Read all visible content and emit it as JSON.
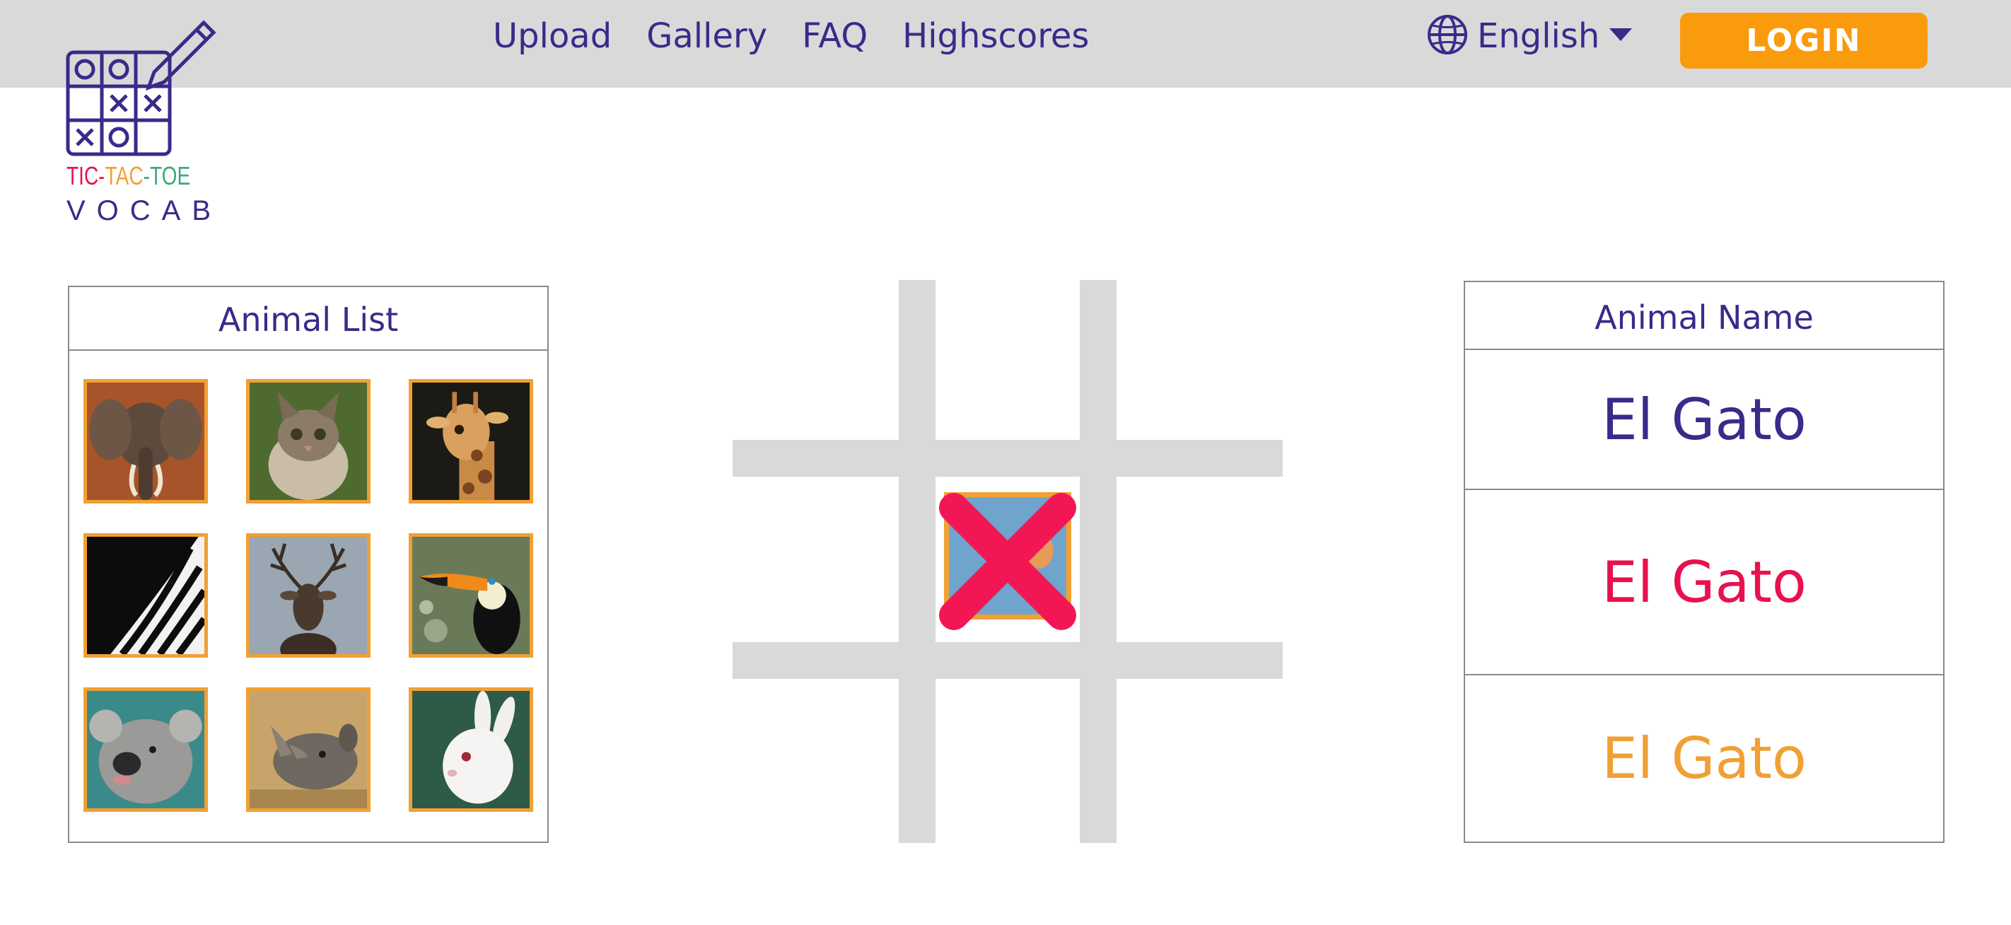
{
  "nav": {
    "items": [
      {
        "label": "Upload"
      },
      {
        "label": "Gallery"
      },
      {
        "label": "FAQ"
      },
      {
        "label": "Highscores"
      }
    ],
    "language": "English",
    "login_label": "LOGIN"
  },
  "logo": {
    "word1": "TIC-TAC-TOE",
    "word2": "VOCAB"
  },
  "animal_list": {
    "title": "Animal List",
    "animals": [
      "elephant",
      "kitten",
      "giraffe",
      "zebra",
      "deer",
      "toucan",
      "koala",
      "rhinoceros",
      "rabbit"
    ]
  },
  "board": {
    "cells": [
      "",
      "",
      "",
      "",
      "X",
      "",
      "",
      "",
      ""
    ],
    "center_image": "bird",
    "mark_color": "#f21754"
  },
  "animal_name": {
    "title": "Animal Name",
    "options": [
      {
        "label": "El Gato",
        "color": "#3a2a8a"
      },
      {
        "label": "El Gato",
        "color": "#e8114e"
      },
      {
        "label": "El Gato",
        "color": "#f0a034"
      }
    ]
  },
  "colors": {
    "nav_text": "#3a2a8a",
    "login_bg": "#f99b0d",
    "topbar_bg": "#d9d9d9",
    "tile_border": "#f0a034"
  }
}
